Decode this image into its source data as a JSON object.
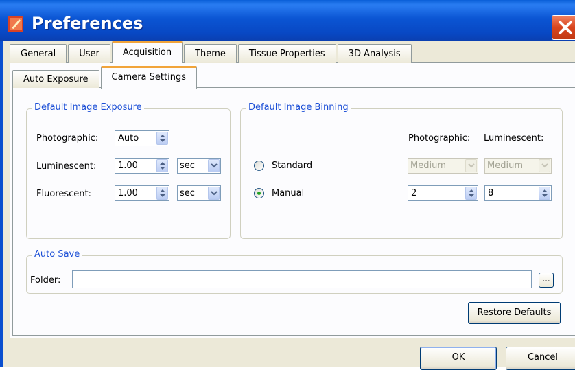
{
  "window": {
    "title": "Preferences"
  },
  "tabs": [
    "General",
    "User",
    "Acquisition",
    "Theme",
    "Tissue Properties",
    "3D Analysis"
  ],
  "subtabs": [
    "Auto Exposure",
    "Camera Settings"
  ],
  "exposure": {
    "title": "Default Image Exposure",
    "photographic_label": "Photographic:",
    "photographic_value": "Auto",
    "luminescent_label": "Luminescent:",
    "luminescent_value": "1.00",
    "luminescent_unit": "sec",
    "fluorescent_label": "Fluorescent:",
    "fluorescent_value": "1.00",
    "fluorescent_unit": "sec"
  },
  "binning": {
    "title": "Default Image Binning",
    "col_photographic": "Photographic:",
    "col_luminescent": "Luminescent:",
    "standard_label": "Standard",
    "standard_photographic": "Medium",
    "standard_luminescent": "Medium",
    "manual_label": "Manual",
    "manual_photographic": "2",
    "manual_luminescent": "8"
  },
  "autosave": {
    "title": "Auto Save",
    "folder_label": "Folder:",
    "folder_value": "",
    "browse_label": "..."
  },
  "buttons": {
    "restore": "Restore Defaults",
    "ok": "OK",
    "cancel": "Cancel"
  }
}
